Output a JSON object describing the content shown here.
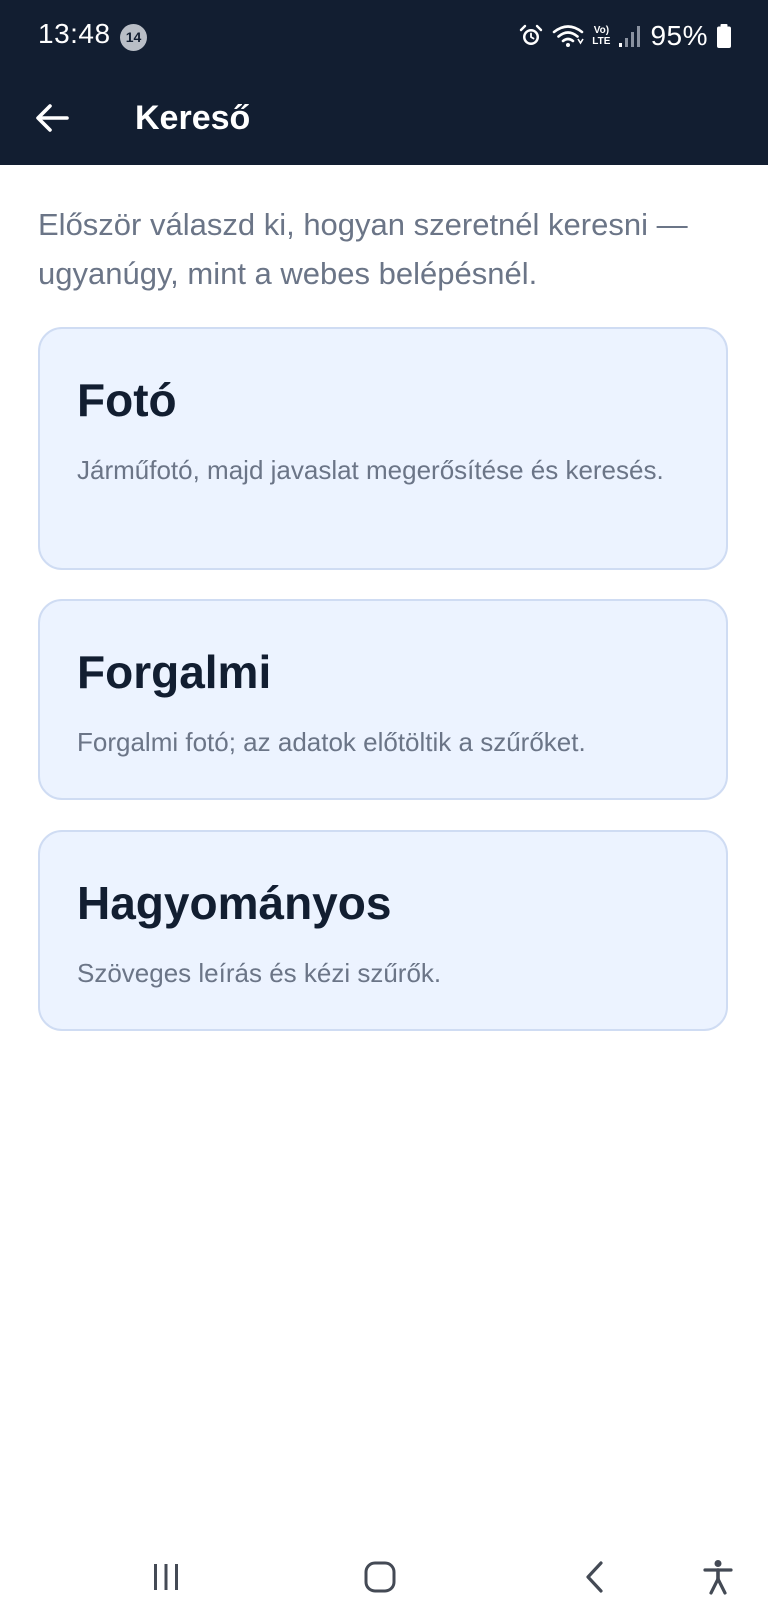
{
  "status_bar": {
    "time": "13:48",
    "notification_count": "14",
    "network_label_top": "Vo)",
    "network_label_bottom": "LTE",
    "battery_percent": "95%"
  },
  "app_bar": {
    "title": "Kereső",
    "back_icon": "arrow-left-icon"
  },
  "intro_text": "Először válaszd ki, hogyan szeretnél keresni — ugyanúgy, mint a webes belépésnél.",
  "options": [
    {
      "title": "Fotó",
      "description": "Járműfotó, majd javaslat megerősítése és keresés."
    },
    {
      "title": "Forgalmi",
      "description": "Forgalmi fotó; az adatok előtöltik a szűrőket."
    },
    {
      "title": "Hagyományos",
      "description": "Szöveges leírás és kézi szűrők."
    }
  ],
  "colors": {
    "header_bg": "#121e31",
    "card_bg": "#ecf3ff",
    "card_border": "#cfdcf3",
    "title_text": "#121e31",
    "secondary_text": "#6b7587"
  },
  "nav_bar": {
    "recents_icon": "recents-icon",
    "home_icon": "home-icon",
    "back_icon": "chevron-left-icon",
    "accessibility_icon": "accessibility-icon"
  }
}
